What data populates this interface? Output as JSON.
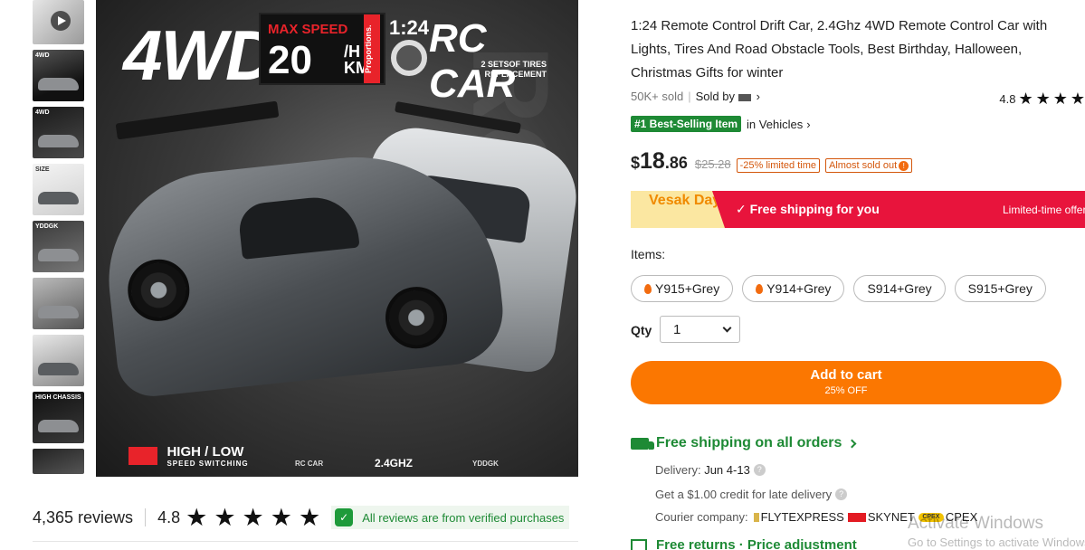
{
  "gallery": {
    "thumbnails": [
      {
        "label": ""
      },
      {
        "label": "4WD"
      },
      {
        "label": "4WD"
      },
      {
        "label": "SIZE"
      },
      {
        "label": "YDDGK"
      },
      {
        "label": ""
      },
      {
        "label": ""
      },
      {
        "label": "HIGH CHASSIS"
      },
      {
        "label": ""
      }
    ],
    "main_image": {
      "big_text": "4WD",
      "max_speed_label": "MAX SPEED",
      "speed_value": "20",
      "speed_unit": "/H KM",
      "proportions": "Proportions.",
      "scale": "1:24",
      "rc_car": "RC CAR",
      "tires_text": "2 SETSOF TIRES REPLACEMENT",
      "high_low": "HIGH / LOW",
      "speed_switching": "SPEED SWITCHING",
      "rc_car_small": "RC CAR",
      "ghz": "2.4GHZ",
      "brand": "YDDGK"
    }
  },
  "reviews": {
    "count_text": "4,365 reviews",
    "rating": "4.8",
    "stars": 5,
    "verified_text": "All reviews are from verified purchases"
  },
  "product": {
    "title": "1:24 Remote Control Drift Car, 2.4Ghz 4WD Remote Control Car with Lights, Tires And Road Obstacle Tools, Best Birthday, Halloween, Christmas Gifts for winter",
    "sold": "50K+ sold",
    "sold_by": "Sold by",
    "rating": "4.8",
    "best_selling_badge": "#1 Best-Selling Item",
    "best_selling_category": "in Vehicles",
    "price_currency": "$",
    "price_int": "18",
    "price_dec": ".86",
    "old_price": "$25.28",
    "discount_tag": "-25% limited time",
    "almost_sold_out": "Almost sold out",
    "promo": {
      "event": "Vesak Day",
      "free_shipping": "Free shipping for you",
      "limited": "Limited-time offer"
    },
    "items_label": "Items:",
    "items": [
      {
        "label": "Y915+Grey",
        "hot": true
      },
      {
        "label": "Y914+Grey",
        "hot": true
      },
      {
        "label": "S914+Grey",
        "hot": false
      },
      {
        "label": "S915+Grey",
        "hot": false
      }
    ],
    "qty_label": "Qty",
    "qty_value": "1",
    "add_to_cart": "Add to cart",
    "add_to_cart_sub": "25% OFF",
    "shipping_title": "Free shipping on all orders",
    "delivery_label": "Delivery:",
    "delivery_value": "Jun 4-13",
    "late_credit": "Get a $1.00 credit for late delivery",
    "courier_label": "Courier company:",
    "couriers": [
      "FLYTEXPRESS",
      "SKYNET",
      "CPEX"
    ],
    "returns_text": "Free returns · Price adjustment"
  },
  "os_overlay": {
    "activate": "Activate Windows",
    "goto": "Go to Settings to activate Windows."
  },
  "colors": {
    "accent_orange": "#fb7701",
    "green": "#1e8a35",
    "promo_red": "#e8143c"
  }
}
